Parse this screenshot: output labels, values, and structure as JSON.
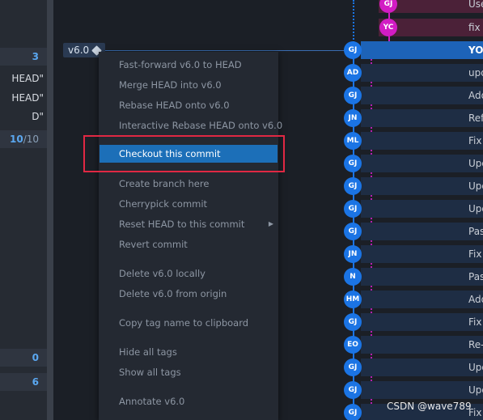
{
  "sidebar": {
    "rows": [
      {
        "kind": "section",
        "count": "3"
      },
      {
        "kind": "text",
        "text": "HEAD\""
      },
      {
        "kind": "text",
        "text": "HEAD\""
      },
      {
        "kind": "text",
        "text": "D\""
      },
      {
        "kind": "section",
        "count_a": "10",
        "count_b": "/10"
      },
      {
        "kind": "section",
        "count": "0"
      },
      {
        "kind": "section",
        "count": "6"
      }
    ]
  },
  "tag": {
    "label": "v6.0",
    "icon": "tag-icon"
  },
  "context_menu": {
    "items": [
      {
        "label": "Fast-forward v6.0 to HEAD"
      },
      {
        "label": "Merge HEAD into v6.0"
      },
      {
        "label": "Rebase HEAD onto v6.0"
      },
      {
        "label": "Interactive Rebase HEAD onto v6.0"
      },
      {
        "label": "Checkout this commit",
        "active": true
      },
      {
        "label": "Create branch here"
      },
      {
        "label": "Cherrypick commit"
      },
      {
        "label": "Reset HEAD to this commit",
        "submenu": "▶"
      },
      {
        "label": "Revert commit"
      },
      {
        "label": "Delete v6.0 locally"
      },
      {
        "label": "Delete v6.0 from origin"
      },
      {
        "label": "Copy tag name to clipboard"
      },
      {
        "label": "Hide all tags"
      },
      {
        "label": "Show all tags"
      },
      {
        "label": "Annotate v6.0"
      }
    ]
  },
  "graph": {
    "commits": [
      {
        "initials": "GJ",
        "color": "mag",
        "message": "Use"
      },
      {
        "initials": "YC",
        "color": "mag",
        "message": "fix"
      },
      {
        "initials": "GJ",
        "color": "blue",
        "message": "YOI",
        "selected": true
      },
      {
        "initials": "AD",
        "color": "blue",
        "message": "upd"
      },
      {
        "initials": "GJ",
        "color": "blue",
        "message": "Add"
      },
      {
        "initials": "JN",
        "color": "blue",
        "message": "Ref"
      },
      {
        "initials": "ML",
        "color": "blue",
        "message": "Fix"
      },
      {
        "initials": "GJ",
        "color": "blue",
        "message": "Upd"
      },
      {
        "initials": "GJ",
        "color": "blue",
        "message": "Upd"
      },
      {
        "initials": "GJ",
        "color": "blue",
        "message": "Upd"
      },
      {
        "initials": "GJ",
        "color": "blue",
        "message": "Pas"
      },
      {
        "initials": "JN",
        "color": "blue",
        "message": "Fix"
      },
      {
        "initials": "N",
        "color": "blue",
        "message": "Pas"
      },
      {
        "initials": "HM",
        "color": "blue",
        "message": "Add"
      },
      {
        "initials": "GJ",
        "color": "blue",
        "message": "Fix"
      },
      {
        "initials": "EO",
        "color": "blue",
        "message": "Re-"
      },
      {
        "initials": "GJ",
        "color": "blue",
        "message": "Upd"
      },
      {
        "initials": "GJ",
        "color": "blue",
        "message": "Upd"
      },
      {
        "initials": "GJ",
        "color": "blue",
        "message": "Fix"
      }
    ],
    "colors": {
      "blue": "#1b74e4",
      "magenta": "#d21cc4",
      "selected_row": "#1d63b8"
    }
  },
  "watermark": "CSDN @wave789"
}
